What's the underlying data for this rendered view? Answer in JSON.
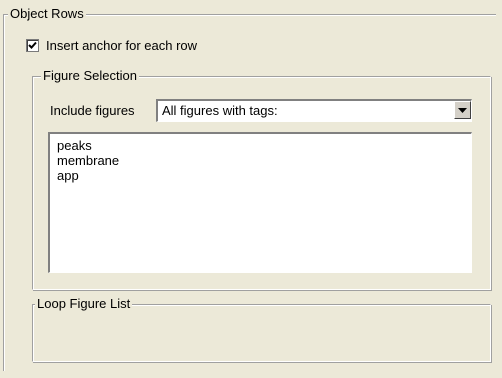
{
  "object_rows": {
    "legend": "Object Rows",
    "insert_anchor": {
      "label": "Insert anchor for each row",
      "checked": true
    }
  },
  "figure_selection": {
    "legend": "Figure Selection",
    "include_label": "Include figures",
    "include_value": "All figures with tags:",
    "tags": [
      "peaks",
      "membrane",
      "app"
    ]
  },
  "loop_figure_list": {
    "legend": "Loop Figure List"
  },
  "icons": {
    "checkbox": "check-icon",
    "dropdown": "dropdown-arrow-icon"
  }
}
